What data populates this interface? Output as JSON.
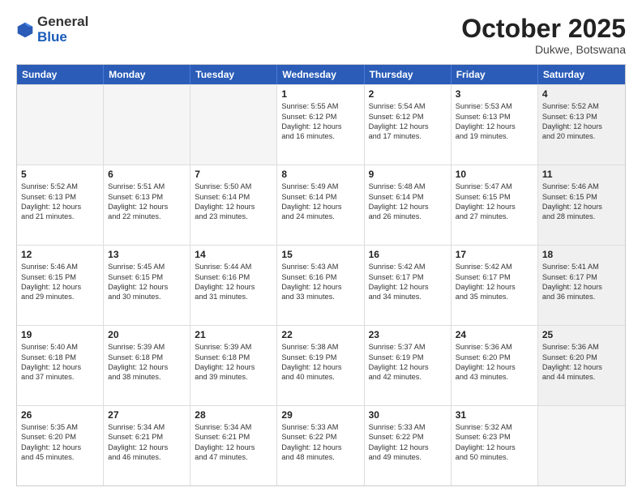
{
  "header": {
    "logo_general": "General",
    "logo_blue": "Blue",
    "month": "October 2025",
    "location": "Dukwe, Botswana"
  },
  "days_of_week": [
    "Sunday",
    "Monday",
    "Tuesday",
    "Wednesday",
    "Thursday",
    "Friday",
    "Saturday"
  ],
  "weeks": [
    [
      {
        "day": "",
        "info": [],
        "empty": true
      },
      {
        "day": "",
        "info": [],
        "empty": true
      },
      {
        "day": "",
        "info": [],
        "empty": true
      },
      {
        "day": "1",
        "info": [
          "Sunrise: 5:55 AM",
          "Sunset: 6:12 PM",
          "Daylight: 12 hours",
          "and 16 minutes."
        ],
        "empty": false,
        "shaded": false
      },
      {
        "day": "2",
        "info": [
          "Sunrise: 5:54 AM",
          "Sunset: 6:12 PM",
          "Daylight: 12 hours",
          "and 17 minutes."
        ],
        "empty": false,
        "shaded": false
      },
      {
        "day": "3",
        "info": [
          "Sunrise: 5:53 AM",
          "Sunset: 6:13 PM",
          "Daylight: 12 hours",
          "and 19 minutes."
        ],
        "empty": false,
        "shaded": false
      },
      {
        "day": "4",
        "info": [
          "Sunrise: 5:52 AM",
          "Sunset: 6:13 PM",
          "Daylight: 12 hours",
          "and 20 minutes."
        ],
        "empty": false,
        "shaded": true
      }
    ],
    [
      {
        "day": "5",
        "info": [
          "Sunrise: 5:52 AM",
          "Sunset: 6:13 PM",
          "Daylight: 12 hours",
          "and 21 minutes."
        ],
        "empty": false,
        "shaded": false
      },
      {
        "day": "6",
        "info": [
          "Sunrise: 5:51 AM",
          "Sunset: 6:13 PM",
          "Daylight: 12 hours",
          "and 22 minutes."
        ],
        "empty": false,
        "shaded": false
      },
      {
        "day": "7",
        "info": [
          "Sunrise: 5:50 AM",
          "Sunset: 6:14 PM",
          "Daylight: 12 hours",
          "and 23 minutes."
        ],
        "empty": false,
        "shaded": false
      },
      {
        "day": "8",
        "info": [
          "Sunrise: 5:49 AM",
          "Sunset: 6:14 PM",
          "Daylight: 12 hours",
          "and 24 minutes."
        ],
        "empty": false,
        "shaded": false
      },
      {
        "day": "9",
        "info": [
          "Sunrise: 5:48 AM",
          "Sunset: 6:14 PM",
          "Daylight: 12 hours",
          "and 26 minutes."
        ],
        "empty": false,
        "shaded": false
      },
      {
        "day": "10",
        "info": [
          "Sunrise: 5:47 AM",
          "Sunset: 6:15 PM",
          "Daylight: 12 hours",
          "and 27 minutes."
        ],
        "empty": false,
        "shaded": false
      },
      {
        "day": "11",
        "info": [
          "Sunrise: 5:46 AM",
          "Sunset: 6:15 PM",
          "Daylight: 12 hours",
          "and 28 minutes."
        ],
        "empty": false,
        "shaded": true
      }
    ],
    [
      {
        "day": "12",
        "info": [
          "Sunrise: 5:46 AM",
          "Sunset: 6:15 PM",
          "Daylight: 12 hours",
          "and 29 minutes."
        ],
        "empty": false,
        "shaded": false
      },
      {
        "day": "13",
        "info": [
          "Sunrise: 5:45 AM",
          "Sunset: 6:15 PM",
          "Daylight: 12 hours",
          "and 30 minutes."
        ],
        "empty": false,
        "shaded": false
      },
      {
        "day": "14",
        "info": [
          "Sunrise: 5:44 AM",
          "Sunset: 6:16 PM",
          "Daylight: 12 hours",
          "and 31 minutes."
        ],
        "empty": false,
        "shaded": false
      },
      {
        "day": "15",
        "info": [
          "Sunrise: 5:43 AM",
          "Sunset: 6:16 PM",
          "Daylight: 12 hours",
          "and 33 minutes."
        ],
        "empty": false,
        "shaded": false
      },
      {
        "day": "16",
        "info": [
          "Sunrise: 5:42 AM",
          "Sunset: 6:17 PM",
          "Daylight: 12 hours",
          "and 34 minutes."
        ],
        "empty": false,
        "shaded": false
      },
      {
        "day": "17",
        "info": [
          "Sunrise: 5:42 AM",
          "Sunset: 6:17 PM",
          "Daylight: 12 hours",
          "and 35 minutes."
        ],
        "empty": false,
        "shaded": false
      },
      {
        "day": "18",
        "info": [
          "Sunrise: 5:41 AM",
          "Sunset: 6:17 PM",
          "Daylight: 12 hours",
          "and 36 minutes."
        ],
        "empty": false,
        "shaded": true
      }
    ],
    [
      {
        "day": "19",
        "info": [
          "Sunrise: 5:40 AM",
          "Sunset: 6:18 PM",
          "Daylight: 12 hours",
          "and 37 minutes."
        ],
        "empty": false,
        "shaded": false
      },
      {
        "day": "20",
        "info": [
          "Sunrise: 5:39 AM",
          "Sunset: 6:18 PM",
          "Daylight: 12 hours",
          "and 38 minutes."
        ],
        "empty": false,
        "shaded": false
      },
      {
        "day": "21",
        "info": [
          "Sunrise: 5:39 AM",
          "Sunset: 6:18 PM",
          "Daylight: 12 hours",
          "and 39 minutes."
        ],
        "empty": false,
        "shaded": false
      },
      {
        "day": "22",
        "info": [
          "Sunrise: 5:38 AM",
          "Sunset: 6:19 PM",
          "Daylight: 12 hours",
          "and 40 minutes."
        ],
        "empty": false,
        "shaded": false
      },
      {
        "day": "23",
        "info": [
          "Sunrise: 5:37 AM",
          "Sunset: 6:19 PM",
          "Daylight: 12 hours",
          "and 42 minutes."
        ],
        "empty": false,
        "shaded": false
      },
      {
        "day": "24",
        "info": [
          "Sunrise: 5:36 AM",
          "Sunset: 6:20 PM",
          "Daylight: 12 hours",
          "and 43 minutes."
        ],
        "empty": false,
        "shaded": false
      },
      {
        "day": "25",
        "info": [
          "Sunrise: 5:36 AM",
          "Sunset: 6:20 PM",
          "Daylight: 12 hours",
          "and 44 minutes."
        ],
        "empty": false,
        "shaded": true
      }
    ],
    [
      {
        "day": "26",
        "info": [
          "Sunrise: 5:35 AM",
          "Sunset: 6:20 PM",
          "Daylight: 12 hours",
          "and 45 minutes."
        ],
        "empty": false,
        "shaded": false
      },
      {
        "day": "27",
        "info": [
          "Sunrise: 5:34 AM",
          "Sunset: 6:21 PM",
          "Daylight: 12 hours",
          "and 46 minutes."
        ],
        "empty": false,
        "shaded": false
      },
      {
        "day": "28",
        "info": [
          "Sunrise: 5:34 AM",
          "Sunset: 6:21 PM",
          "Daylight: 12 hours",
          "and 47 minutes."
        ],
        "empty": false,
        "shaded": false
      },
      {
        "day": "29",
        "info": [
          "Sunrise: 5:33 AM",
          "Sunset: 6:22 PM",
          "Daylight: 12 hours",
          "and 48 minutes."
        ],
        "empty": false,
        "shaded": false
      },
      {
        "day": "30",
        "info": [
          "Sunrise: 5:33 AM",
          "Sunset: 6:22 PM",
          "Daylight: 12 hours",
          "and 49 minutes."
        ],
        "empty": false,
        "shaded": false
      },
      {
        "day": "31",
        "info": [
          "Sunrise: 5:32 AM",
          "Sunset: 6:23 PM",
          "Daylight: 12 hours",
          "and 50 minutes."
        ],
        "empty": false,
        "shaded": false
      },
      {
        "day": "",
        "info": [],
        "empty": true,
        "shaded": true
      }
    ]
  ]
}
